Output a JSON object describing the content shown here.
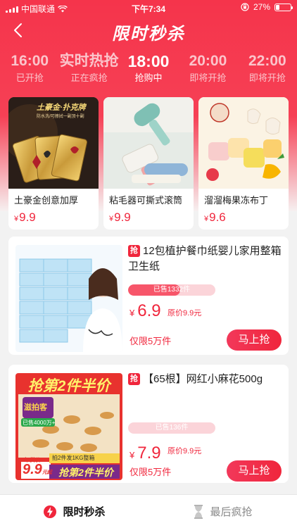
{
  "status_bar": {
    "carrier": "中国联通",
    "time": "下午7:34",
    "battery": "27%",
    "battery_level": 0.27
  },
  "nav": {
    "title": "限时秒杀"
  },
  "timeslots": [
    {
      "time": "16:00",
      "status": "已开抢",
      "active": false
    },
    {
      "time": "实时热抢",
      "status": "正在疯抢",
      "active": false
    },
    {
      "time": "18:00",
      "status": "抢购中",
      "active": true
    },
    {
      "time": "20:00",
      "status": "即将开抢",
      "active": false
    },
    {
      "time": "22:00",
      "status": "即将开抢",
      "active": false
    }
  ],
  "top_products": [
    {
      "name": "土豪金创意加厚",
      "currency": "¥",
      "price": "9.9",
      "banner": "土豪金·扑克牌",
      "banner_sub": "防水洗/可擦拭一副顶十副"
    },
    {
      "name": "粘毛器可撕式滚筒",
      "currency": "¥",
      "price": "9.9"
    },
    {
      "name": "溜溜梅果冻布丁",
      "currency": "¥",
      "price": "9.6"
    }
  ],
  "list_products": [
    {
      "badge": "抢",
      "title": "12包植护餐巾纸婴儿家用整箱卫生纸",
      "sold": "已售1332件",
      "sold_fraction": 0.6,
      "currency": "¥",
      "price": "6.9",
      "original": "原价9.9元",
      "limit": "仅限5万件",
      "button": "马上抢"
    },
    {
      "badge": "抢",
      "title": "【65根】网红小麻花500g",
      "sold": "已售136件",
      "sold_fraction": 0.0,
      "currency": "¥",
      "price": "7.9",
      "original": "原价9.9元",
      "limit": "仅限5万件",
      "button": "马上抢",
      "promo_top": "抢第2件半价",
      "promo_brand": "滋拍客",
      "promo_mid": "已售4000万+",
      "promo_gift": "拍2件发1KG整箱",
      "promo_price": "9.9",
      "promo_price_unit": "元起",
      "promo_price_tag": "年货价",
      "promo_bottom": "抢第2件半价"
    }
  ],
  "tabbar": {
    "items": [
      {
        "label": "限时秒杀",
        "icon": "lightning-icon",
        "active": true
      },
      {
        "label": "最后疯抢",
        "icon": "hourglass-icon",
        "active": false
      }
    ]
  },
  "colors": {
    "accent": "#f0263c",
    "hero_top": "#f5344b",
    "progress_bg": "#fbd4d9"
  }
}
